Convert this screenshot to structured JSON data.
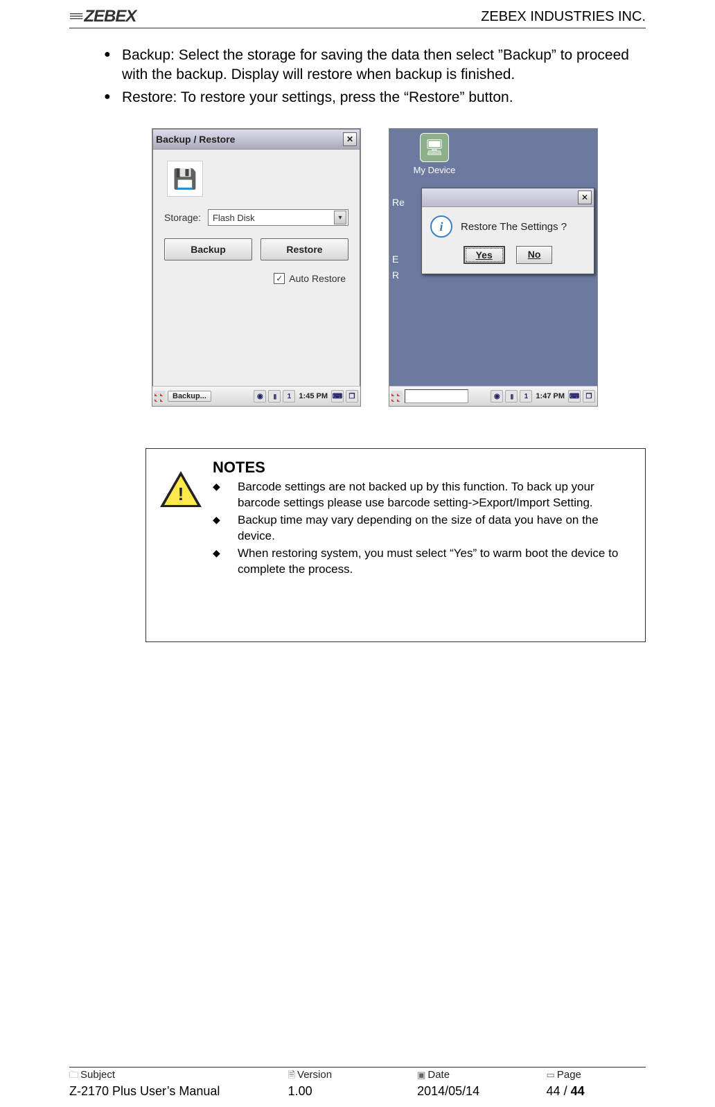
{
  "header": {
    "logo_text": "ZEBEX",
    "company": "ZEBEX INDUSTRIES INC."
  },
  "bullets": {
    "b1": "Backup: Select the storage for saving the data then select ”Backup” to proceed with the backup. Display will restore when backup is finished.",
    "b2": "Restore: To restore your settings, press the “Restore” button."
  },
  "screenshot_left": {
    "title": "Backup / Restore",
    "storage_label": "Storage:",
    "storage_value": "Flash Disk",
    "backup_btn": "Backup",
    "restore_btn": "Restore",
    "auto_restore": "Auto Restore",
    "taskbar_app": "Backup...",
    "clock": "1:45 PM",
    "tray1": "1"
  },
  "screenshot_right": {
    "mydevice": "My Device",
    "left_text_1": "Re",
    "left_text_2": "E",
    "left_text_3": "R",
    "dialog_text": "Restore The Settings ?",
    "yes": "Yes",
    "no": "No",
    "clock": "1:47 PM",
    "tray1": "1"
  },
  "notes": {
    "title": "NOTES",
    "n1": "Barcode settings are not backed up by this function. To back up your barcode settings please use barcode setting->Export/Import Setting.",
    "n2": "Backup time may vary depending on the size of data you have on the device.",
    "n3": "When restoring system, you must select “Yes” to warm boot the device to complete the process."
  },
  "footer": {
    "subject_label": "Subject",
    "subject_value": "Z-2170 Plus User’s Manual",
    "version_label": "Version",
    "version_value": "1.00",
    "date_label": "Date",
    "date_value": "2014/05/14",
    "page_label": "Page",
    "page_current": "44",
    "page_sep": " / ",
    "page_total": "44"
  }
}
